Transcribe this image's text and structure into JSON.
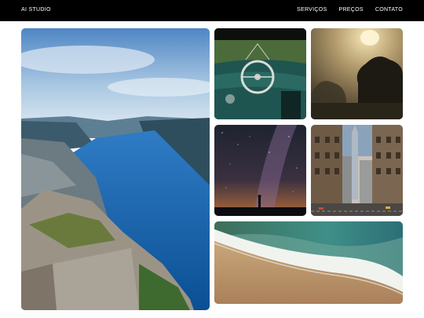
{
  "header": {
    "brand": "AI STUDIO",
    "nav": [
      "SERVIÇOS",
      "PREÇOS",
      "CONTATO"
    ]
  },
  "gallery": {
    "images": [
      {
        "subject": "fjord-cliff-photo"
      },
      {
        "subject": "vintage-car-dashboard-photo"
      },
      {
        "subject": "foggy-trees-sunrise-photo"
      },
      {
        "subject": "milky-way-silhouette-photo"
      },
      {
        "subject": "city-street-skyscraper-photo"
      },
      {
        "subject": "beach-waves-photo"
      }
    ]
  }
}
